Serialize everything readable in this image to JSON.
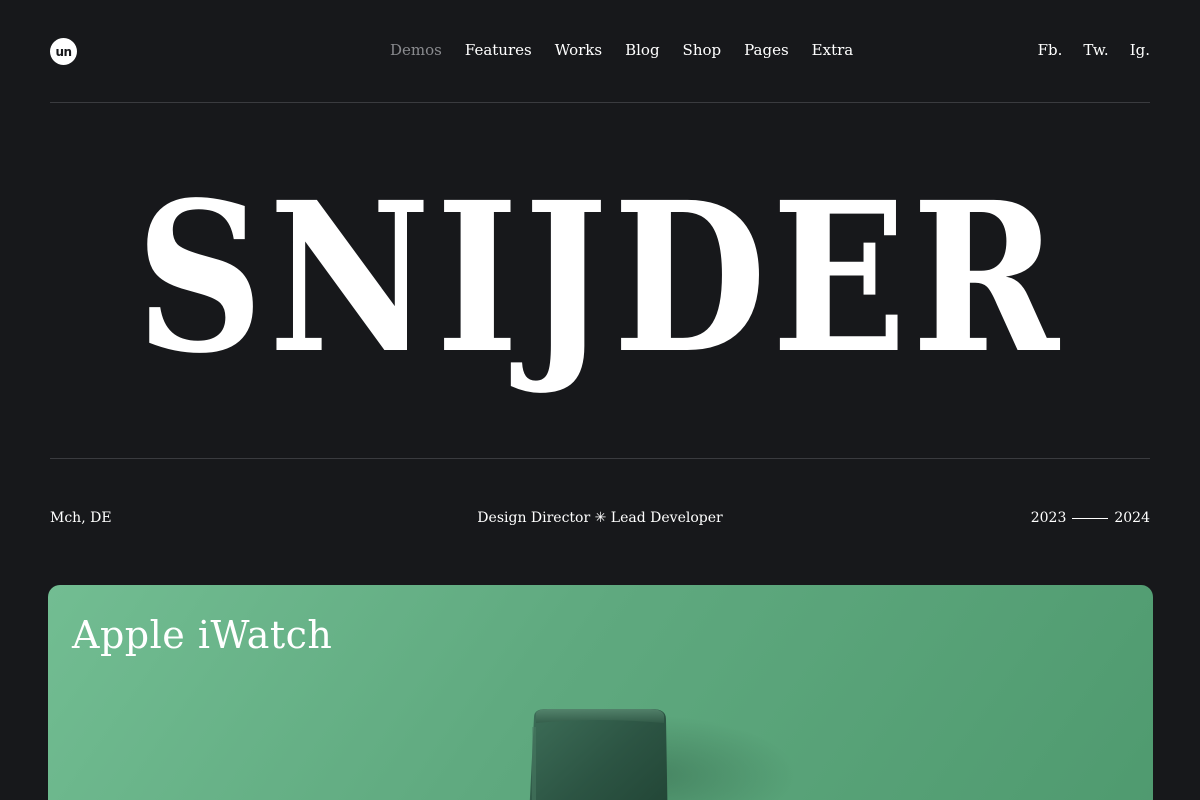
{
  "header": {
    "logo_text": "un",
    "nav": [
      {
        "label": "Demos",
        "active": true
      },
      {
        "label": "Features"
      },
      {
        "label": "Works"
      },
      {
        "label": "Blog"
      },
      {
        "label": "Shop"
      },
      {
        "label": "Pages"
      },
      {
        "label": "Extra"
      }
    ],
    "social": [
      "Fb.",
      "Tw.",
      "Ig."
    ]
  },
  "hero": {
    "title": "SNIJDER"
  },
  "info": {
    "location": "Mch, DE",
    "role": "Design Director ✳ Lead Developer",
    "year_start": "2023",
    "year_end": "2024"
  },
  "card": {
    "title": "Apple iWatch",
    "background_color": "#5fa97f",
    "image": "apple-watch"
  },
  "colors": {
    "background": "#17181b",
    "text": "#ffffff",
    "muted": "#8a8b8f",
    "divider": "#3a3b3f"
  }
}
